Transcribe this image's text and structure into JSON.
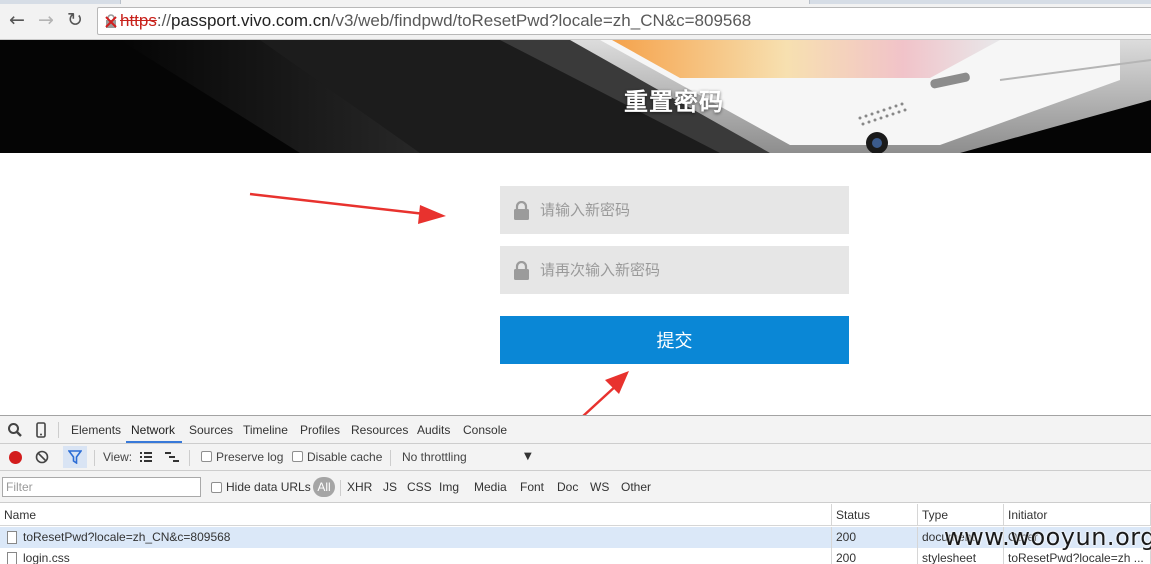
{
  "browser": {
    "url_scheme": "https",
    "url_sep": "://",
    "url_host": "passport.vivo.com.cn",
    "url_path": "/v3/web/findpwd/toResetPwd?locale=zh_CN&c=809568"
  },
  "hero": {
    "title": "重置密码"
  },
  "form": {
    "new_password_placeholder": "请输入新密码",
    "confirm_password_placeholder": "请再次输入新密码",
    "submit_label": "提交"
  },
  "devtools": {
    "tabs": [
      "Elements",
      "Network",
      "Sources",
      "Timeline",
      "Profiles",
      "Resources",
      "Audits",
      "Console"
    ],
    "active_tab": "Network",
    "toolbar": {
      "view_label": "View:",
      "preserve_log": "Preserve log",
      "disable_cache": "Disable cache",
      "throttling": "No throttling"
    },
    "filterbar": {
      "filter_placeholder": "Filter",
      "hide_data_urls": "Hide data URLs",
      "all": "All",
      "types": [
        "XHR",
        "JS",
        "CSS",
        "Img",
        "Media",
        "Font",
        "Doc",
        "WS",
        "Other"
      ]
    },
    "table": {
      "headers": {
        "name": "Name",
        "status": "Status",
        "type": "Type",
        "initiator": "Initiator"
      },
      "rows": [
        {
          "name": "toResetPwd?locale=zh_CN&c=809568",
          "status": "200",
          "type": "document",
          "initiator": "Other"
        },
        {
          "name": "login.css",
          "status": "200",
          "type": "stylesheet",
          "initiator": "toResetPwd?locale=zh ..."
        }
      ]
    }
  },
  "watermark": "www.wooyun.org",
  "colors": {
    "submit_blue": "#0a87d6",
    "annotation_red": "#e8322e",
    "field_gray": "#e6e6e6"
  }
}
